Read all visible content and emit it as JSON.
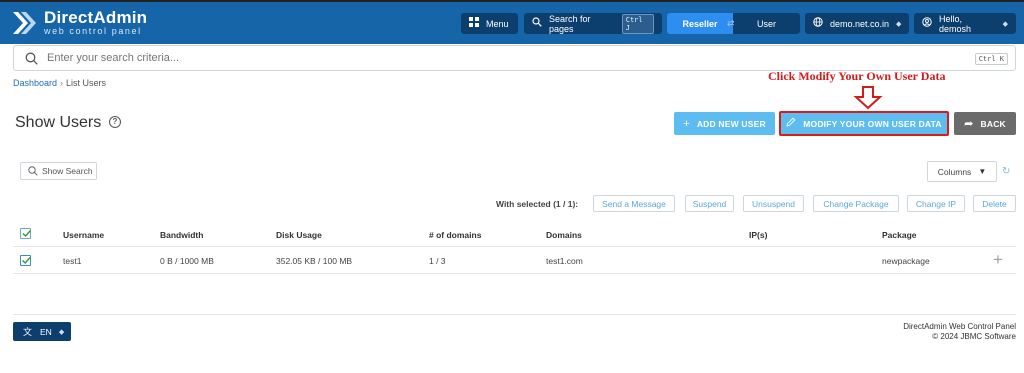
{
  "header": {
    "brand_title": "DirectAdmin",
    "brand_sub": "web control panel",
    "menu_label": "Menu",
    "search_pages_label": "Search for pages",
    "search_pages_shortcut": "Ctrl J",
    "role_active": "Reseller",
    "role_other": "User",
    "domain": "demo.net.co.in",
    "greeting": "Hello, demosh"
  },
  "search": {
    "placeholder": "Enter your search criteria...",
    "shortcut": "Ctrl K"
  },
  "breadcrumb": {
    "home": "Dashboard",
    "separator": "›",
    "current": "List Users"
  },
  "annotation": {
    "text": "Click Modify Your Own User Data",
    "color": "#d41b1b"
  },
  "page": {
    "title": "Show Users",
    "help_glyph": "?"
  },
  "buttons": {
    "add_user": "ADD NEW USER",
    "modify": "MODIFY YOUR OWN USER DATA",
    "back": "BACK"
  },
  "toolbar": {
    "show_search": "Show Search",
    "columns": "Columns",
    "with_selected": "With selected (1 / 1):",
    "actions": [
      "Send a Message",
      "Suspend",
      "Unsuspend",
      "Change Package",
      "Change IP",
      "Delete"
    ]
  },
  "table": {
    "headers": {
      "username": "Username",
      "bandwidth": "Bandwidth",
      "disk": "Disk Usage",
      "domains_count": "# of domains",
      "domains": "Domains",
      "ips": "IP(s)",
      "package": "Package"
    },
    "rows": [
      {
        "username": "test1",
        "bandwidth": "0 B / 1000 MB",
        "disk": "352.05 KB / 100 MB",
        "domains_count": "1 / 3",
        "domains": "test1.com",
        "ips": "",
        "package": "newpackage",
        "selected": true
      }
    ]
  },
  "footer": {
    "language": "EN",
    "line1": "DirectAdmin Web Control Panel",
    "line2": "© 2024 JBMC Software"
  },
  "colors": {
    "header_bg": "#1565a8",
    "dark_button": "#0d3f6e",
    "primary_button": "#5dbcf0",
    "back_button": "#6b6b6b",
    "highlight_border": "#d91b1b"
  }
}
